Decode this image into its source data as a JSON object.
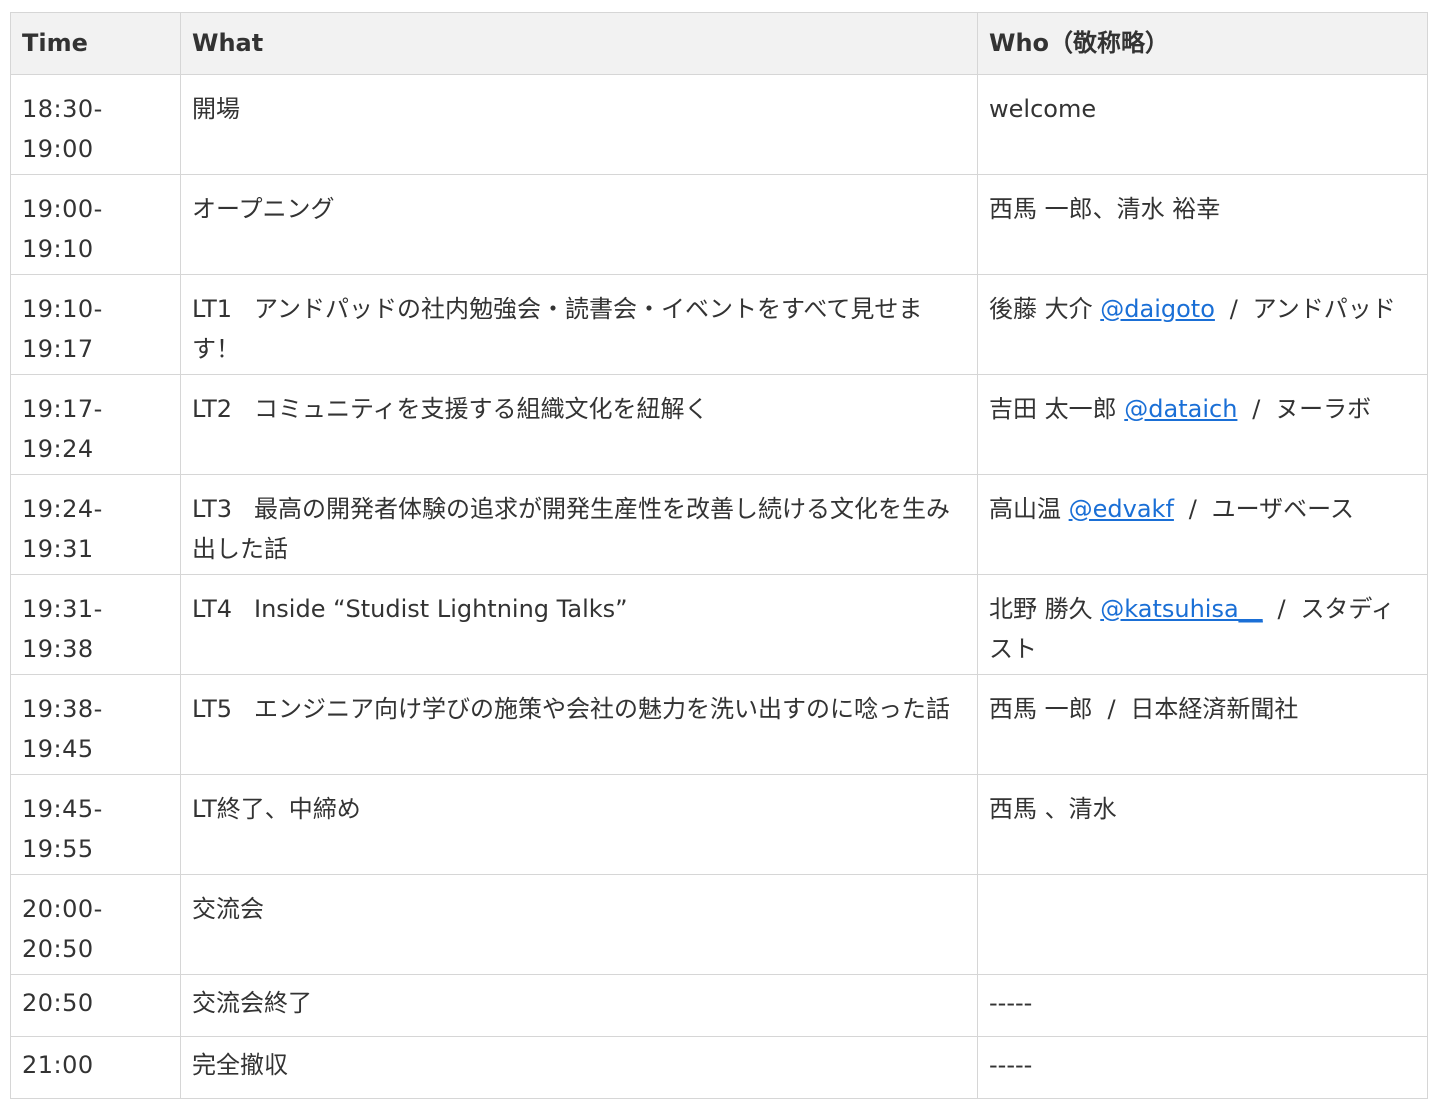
{
  "header": {
    "time": "Time",
    "what": "What",
    "who": "Who（敬称略）"
  },
  "rows": [
    {
      "time_start": "18:30-",
      "time_end": "19:00",
      "what_label": "",
      "what": "開場",
      "who_name": "welcome",
      "who_handle": "",
      "who_org": ""
    },
    {
      "time_start": "19:00-",
      "time_end": "19:10",
      "what_label": "",
      "what": "オープニング",
      "who_name": "西馬 一郎、清水 裕幸",
      "who_handle": "",
      "who_org": ""
    },
    {
      "time_start": "19:10-",
      "time_end": "19:17",
      "what_label": "LT1",
      "what": "アンドパッドの社内勉強会・読書会・イベントをすべて見せます！",
      "who_name": "後藤 大介",
      "who_handle": "@daigoto",
      "who_org": "アンドパッド"
    },
    {
      "time_start": "19:17-",
      "time_end": "19:24",
      "what_label": "LT2",
      "what": "コミュニティを支援する組織文化を紐解く",
      "who_name": "吉田 太一郎",
      "who_handle": "@dataich",
      "who_org": "ヌーラボ"
    },
    {
      "time_start": "19:24-",
      "time_end": "19:31",
      "what_label": "LT3",
      "what": "最高の開発者体験の追求が開発生産性を改善し続ける文化を生み出した話",
      "who_name": "高山温",
      "who_handle": "@edvakf",
      "who_org": "ユーザベース"
    },
    {
      "time_start": "19:31-",
      "time_end": "19:38",
      "what_label": "LT4",
      "what": "Inside “Studist Lightning Talks”",
      "who_name": "北野 勝久",
      "who_handle": "@katsuhisa__",
      "who_org": "スタディスト"
    },
    {
      "time_start": "19:38-",
      "time_end": "19:45",
      "what_label": "LT5",
      "what": "エンジニア向け学びの施策や会社の魅力を洗い出すのに唸った話",
      "who_name": "西馬 一郎",
      "who_handle": "",
      "who_org": "日本経済新聞社"
    },
    {
      "time_start": "19:45-",
      "time_end": "19:55",
      "what_label": "",
      "what": "LT終了、中締め",
      "who_name": "西馬 、清水",
      "who_handle": "",
      "who_org": ""
    },
    {
      "time_start": "20:00-",
      "time_end": "20:50",
      "what_label": "",
      "what": "交流会",
      "who_name": "",
      "who_handle": "",
      "who_org": ""
    },
    {
      "time_start": "20:50",
      "time_end": "",
      "what_label": "",
      "what": "交流会終了",
      "who_name": "-----",
      "who_handle": "",
      "who_org": ""
    },
    {
      "time_start": "21:00",
      "time_end": "",
      "what_label": "",
      "what": "完全撤収",
      "who_name": "-----",
      "who_handle": "",
      "who_org": ""
    }
  ],
  "separator": "/"
}
